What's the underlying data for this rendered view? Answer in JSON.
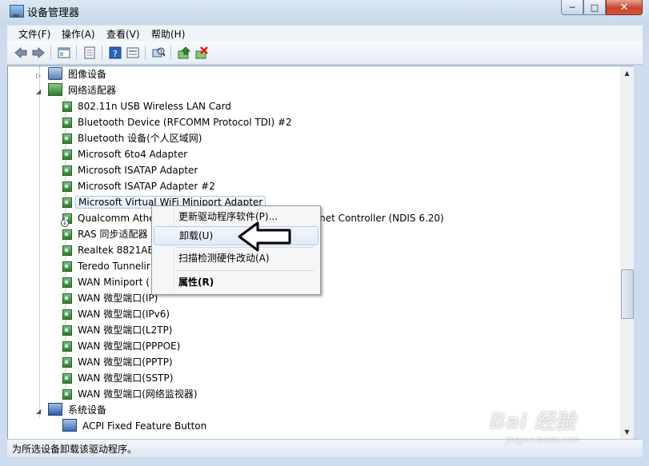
{
  "window": {
    "title": "设备管理器",
    "minimize": "─",
    "maximize": "□",
    "close": "✕"
  },
  "menubar": {
    "items": [
      "文件(F)",
      "操作(A)",
      "查看(V)",
      "帮助(H)"
    ]
  },
  "toolbar": {
    "icons": [
      "back-icon",
      "forward-icon",
      "show-hide-console-tree-icon",
      "properties-icon",
      "help-icon",
      "view-icon",
      "scan-hardware-icon",
      "update-driver-icon",
      "uninstall-icon"
    ]
  },
  "tree": {
    "imaging_category": "图像设备",
    "network_category": "网络适配器",
    "adapters": [
      "802.11n USB Wireless LAN Card",
      "Bluetooth Device (RFCOMM Protocol TDI) #2",
      "Bluetooth 设备(个人区域网)",
      "Microsoft 6to4 Adapter",
      "Microsoft ISATAP Adapter",
      "Microsoft ISATAP Adapter #2",
      "Microsoft Virtual WiFi Miniport Adapter",
      "Qualcomm Athe",
      "RAS 同步适配器",
      "Realtek 8821AE",
      "Teredo Tunnelir",
      "WAN Miniport (",
      "WAN 微型端口(IP)",
      "WAN 微型端口(IPv6)",
      "WAN 微型端口(L2TP)",
      "WAN 微型端口(PPPOE)",
      "WAN 微型端口(PPTP)",
      "WAN 微型端口(SSTP)",
      "WAN 微型端口(网络监视器)"
    ],
    "qualcomm_tail": "ernet Controller (NDIS 6.20)",
    "system_category": "系统设备",
    "system_first": "ACPI Fixed Feature Button"
  },
  "context_menu": {
    "update_driver": "更新驱动程序软件(P)...",
    "uninstall": "卸载(U)",
    "scan": "扫描检测硬件改动(A)",
    "properties": "属性(R)"
  },
  "status": {
    "text": "为所选设备卸载该驱动程序。"
  },
  "watermark": {
    "brand": "Bai 经验",
    "url": "jingyan.baidu.com"
  }
}
